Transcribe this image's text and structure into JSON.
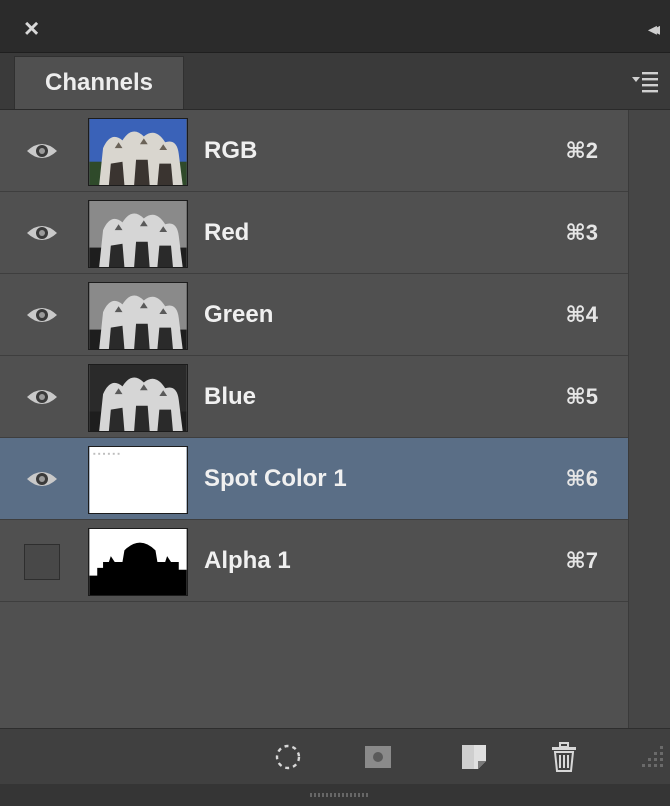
{
  "panel": {
    "tab_label": "Channels"
  },
  "channels": [
    {
      "name": "RGB",
      "shortcut": "⌘2",
      "visible": true,
      "selected": false,
      "thumb": "rgb"
    },
    {
      "name": "Red",
      "shortcut": "⌘3",
      "visible": true,
      "selected": false,
      "thumb": "gray"
    },
    {
      "name": "Green",
      "shortcut": "⌘4",
      "visible": true,
      "selected": false,
      "thumb": "gray"
    },
    {
      "name": "Blue",
      "shortcut": "⌘5",
      "visible": true,
      "selected": false,
      "thumb": "gray-dark"
    },
    {
      "name": "Spot Color 1",
      "shortcut": "⌘6",
      "visible": true,
      "selected": true,
      "thumb": "white"
    },
    {
      "name": "Alpha 1",
      "shortcut": "⌘7",
      "visible": false,
      "selected": false,
      "thumb": "alpha"
    }
  ],
  "footer_buttons": [
    {
      "name": "load-channel-as-selection-icon"
    },
    {
      "name": "save-selection-as-channel-icon"
    },
    {
      "name": "create-new-channel-icon"
    },
    {
      "name": "delete-channel-icon"
    }
  ],
  "colors": {
    "selected_row": "#5a6e86",
    "row_bg": "#505050",
    "panel_bg": "#474747"
  }
}
